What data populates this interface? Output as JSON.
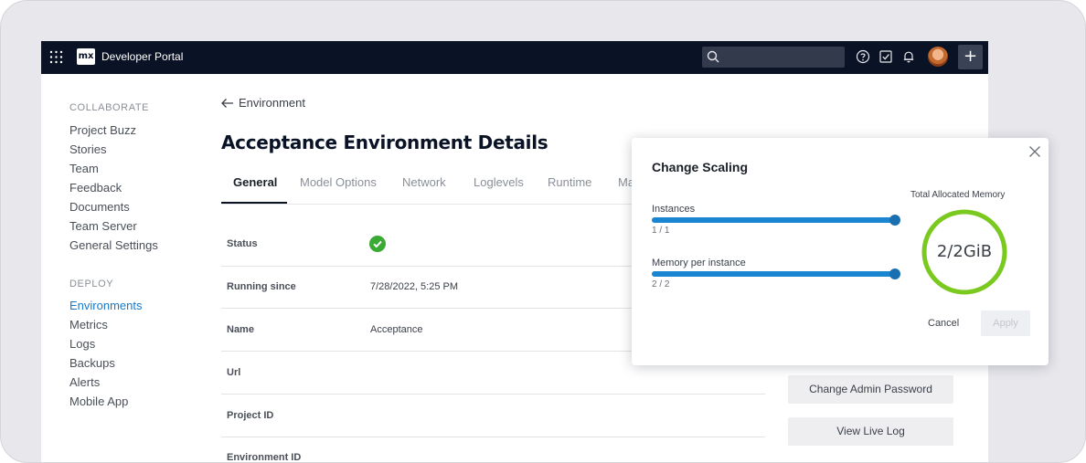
{
  "topbar": {
    "app_title": "Developer Portal",
    "logo_text": "mx",
    "plus_label": "+"
  },
  "sidebar": {
    "collaborate_header": "COLLABORATE",
    "collaborate_items": [
      {
        "label": "Project Buzz"
      },
      {
        "label": "Stories"
      },
      {
        "label": "Team"
      },
      {
        "label": "Feedback"
      },
      {
        "label": "Documents"
      },
      {
        "label": "Team Server"
      },
      {
        "label": "General Settings"
      }
    ],
    "deploy_header": "DEPLOY",
    "deploy_items": [
      {
        "label": "Environments",
        "active": true
      },
      {
        "label": "Metrics"
      },
      {
        "label": "Logs"
      },
      {
        "label": "Backups"
      },
      {
        "label": "Alerts"
      },
      {
        "label": "Mobile App"
      }
    ]
  },
  "main": {
    "back_label": "Environment",
    "title": "Acceptance Environment Details",
    "tabs": [
      {
        "label": "General",
        "active": true
      },
      {
        "label": "Model Options"
      },
      {
        "label": "Network"
      },
      {
        "label": "Loglevels"
      },
      {
        "label": "Runtime"
      },
      {
        "label": "Ma"
      }
    ],
    "rows": [
      {
        "label": "Status",
        "value": ""
      },
      {
        "label": "Running since",
        "value": "7/28/2022, 5:25 PM"
      },
      {
        "label": "Name",
        "value": "Acceptance"
      },
      {
        "label": "Url",
        "value": ""
      },
      {
        "label": "Project ID",
        "value": ""
      },
      {
        "label": "Environment ID",
        "value": ""
      }
    ],
    "actions": [
      {
        "label": "Change Admin Password"
      },
      {
        "label": "View Live Log"
      }
    ]
  },
  "modal": {
    "title": "Change Scaling",
    "instances": {
      "label": "Instances",
      "count": "1 / 1",
      "fraction": 1.0
    },
    "memory": {
      "label": "Memory per instance",
      "count": "2 / 2",
      "fraction": 1.0
    },
    "total_title": "Total Allocated Memory",
    "total_value": "2/2GiB",
    "total_fraction": 1.0,
    "cancel_label": "Cancel",
    "apply_label": "Apply"
  },
  "colors": {
    "topbar": "#0a1325",
    "accent": "#1a85d0",
    "active_nav": "#1a7ac8",
    "ring": "#7ac91e",
    "status_ok": "#3aaa35"
  },
  "icons": {
    "topbar": [
      "grid-icon",
      "search-icon",
      "help-icon",
      "checkbox-icon",
      "bell-icon",
      "avatar",
      "plus-icon"
    ],
    "back": "arrow-left-icon",
    "status": "check-circle-icon",
    "modal_close": "close-icon"
  }
}
